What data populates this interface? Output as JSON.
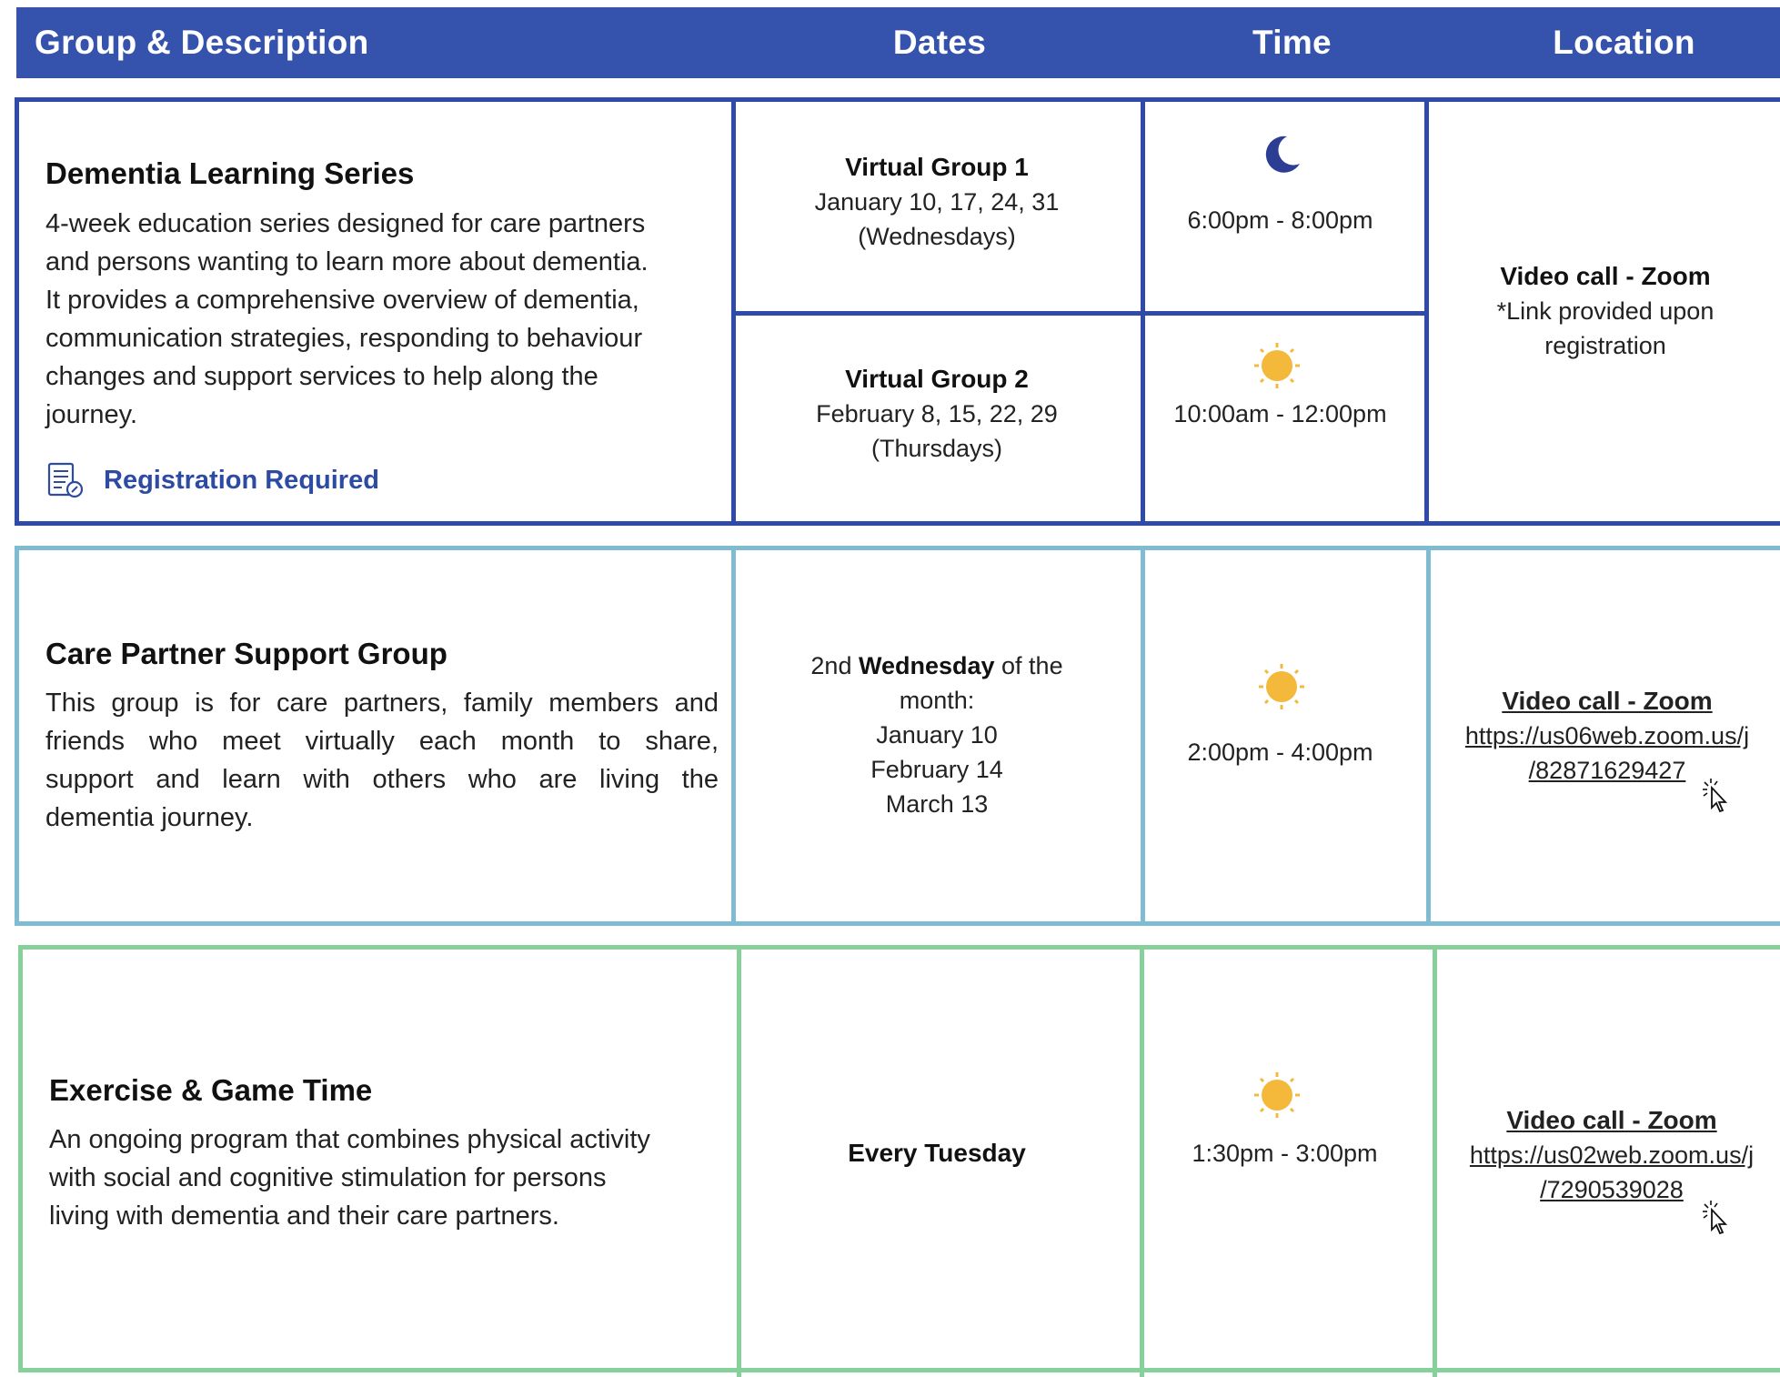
{
  "header": {
    "col_group": "Group & Description",
    "col_dates": "Dates",
    "col_time": "Time",
    "col_location": "Location"
  },
  "colors": {
    "header_bg": "#3552ad",
    "section1_border": "#2f4aa8",
    "section2_border": "#7fbcd4",
    "section3_border": "#86d19a",
    "sun": "#f4b83a",
    "moon": "#2c3e94"
  },
  "rows": {
    "dementia": {
      "title": "Dementia Learning Series",
      "description_lines": [
        "4-week education series designed for care partners",
        "and persons wanting to learn more about dementia.",
        "It provides a comprehensive overview of dementia,",
        "communication strategies, responding to behaviour",
        "changes and support services to help along the",
        "journey."
      ],
      "registration": "Registration Required",
      "group1": {
        "name": "Virtual Group 1",
        "dates": "January 10, 17, 24, 31",
        "days": "(Wednesdays)",
        "time": "6:00pm - 8:00pm",
        "time_icon": "moon-icon"
      },
      "group2": {
        "name": "Virtual Group 2",
        "dates": "February 8, 15, 22, 29",
        "days": "(Thursdays)",
        "time": "10:00am - 12:00pm",
        "time_icon": "sun-icon"
      },
      "location": {
        "title": "Video call - Zoom",
        "note_line1": "*Link provided upon",
        "note_line2": "registration"
      }
    },
    "care_partner": {
      "title": "Care Partner Support Group",
      "description_lines": [
        "This group is for care partners, family members and",
        "friends who meet virtually each month to share,",
        "support and learn with others who are living the",
        "dementia journey."
      ],
      "dates_prefix": "2nd ",
      "dates_bold": "Wednesday",
      "dates_suffix": " of the",
      "dates_line2": "month:",
      "dates_list": [
        "January 10",
        "February 14",
        "March 13"
      ],
      "time": "2:00pm - 4:00pm",
      "time_icon": "sun-icon",
      "location": {
        "title": "Video call - Zoom",
        "link_line1": "https://us06web.zoom.us/j",
        "link_line2": "/82871629427"
      }
    },
    "exercise": {
      "title": "Exercise & Game Time",
      "description_lines": [
        "An ongoing program that combines physical activity",
        "with social and cognitive stimulation for persons",
        "living with dementia and their care partners."
      ],
      "dates": "Every Tuesday",
      "time": "1:30pm - 3:00pm",
      "time_icon": "sun-icon",
      "location": {
        "title": "Video call - Zoom",
        "link_line1": "https://us02web.zoom.us/j",
        "link_line2": "/7290539028"
      }
    }
  }
}
